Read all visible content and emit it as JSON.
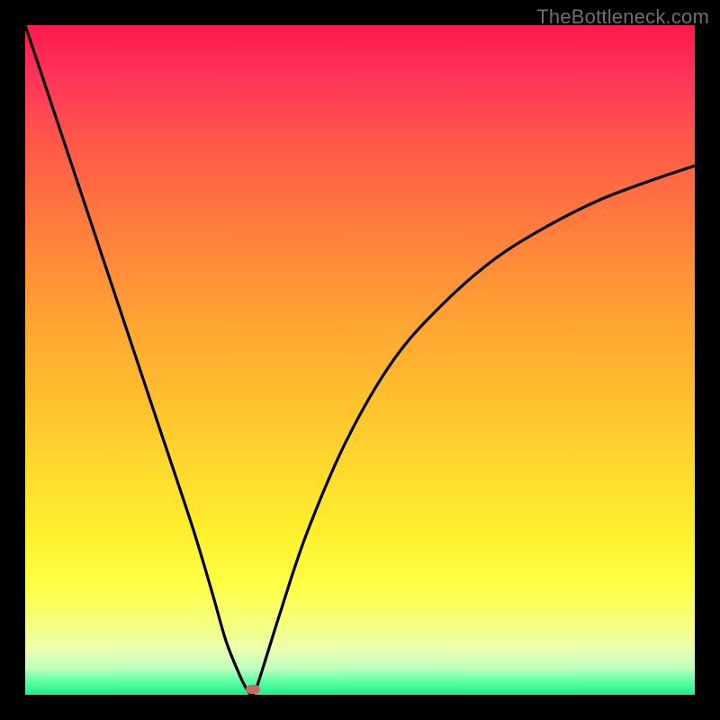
{
  "watermark": "TheBottleneck.com",
  "chart_data": {
    "type": "line",
    "title": "",
    "xlabel": "",
    "ylabel": "",
    "xlim": [
      0,
      100
    ],
    "ylim": [
      0,
      100
    ],
    "grid": false,
    "series": [
      {
        "name": "bottleneck-curve",
        "x": [
          0,
          5,
          10,
          15,
          20,
          25,
          28,
          30,
          32,
          33,
          33.8,
          34.5,
          35.5,
          38,
          42,
          48,
          55,
          62,
          70,
          78,
          86,
          94,
          100
        ],
        "y": [
          100,
          85,
          70,
          55,
          40,
          25,
          15,
          8,
          3,
          1,
          0,
          1,
          4,
          12,
          24,
          38,
          50,
          58,
          65,
          70,
          74,
          77,
          79
        ]
      }
    ],
    "marker": {
      "x": 34,
      "y": 0.8
    },
    "colors": {
      "background_gradient_top": "#ff1a4d",
      "background_gradient_bottom": "#21ed8a",
      "curve": "#000000",
      "marker": "#c76a5f",
      "frame": "#000000"
    }
  }
}
